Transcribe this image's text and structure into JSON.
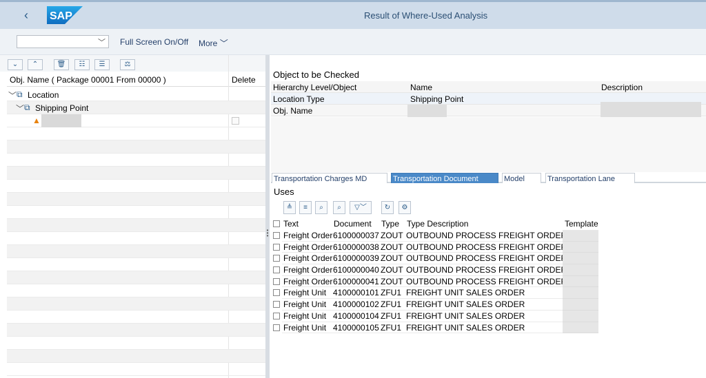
{
  "shell": {
    "back_icon": "chevron-left-icon",
    "logo_text": "SAP",
    "title": "Result of Where-Used Analysis",
    "brand_color": "#1a73c8"
  },
  "toolbar": {
    "select_value": "",
    "fullscreen_label": "Full Screen On/Off",
    "more_label": "More"
  },
  "left_panel": {
    "toolbar_icons": [
      "expand-all-icon",
      "collapse-all-icon",
      "delete-icon",
      "select-all-icon",
      "deselect-all-icon",
      "compare-icon"
    ],
    "columns": {
      "name": "Obj. Name ( Package 00001 From 00000 )",
      "delete": "Delete"
    },
    "tree": [
      {
        "label": "Location",
        "level": 0
      },
      {
        "label": "Shipping Point",
        "level": 1
      }
    ]
  },
  "object_to_check": {
    "title": "Object to be Checked",
    "columns": [
      "Hierarchy Level/Object",
      "Name",
      "Description"
    ],
    "rows": [
      {
        "level": "Location Type",
        "name": "Shipping Point",
        "description": ""
      },
      {
        "level": "Obj. Name",
        "name": "",
        "description": ""
      }
    ]
  },
  "tabs": [
    {
      "label": "Transportation Charges MD",
      "active": false
    },
    {
      "label": "Transportation Document",
      "active": true
    },
    {
      "label": "Model",
      "active": false
    },
    {
      "label": "Transportation Lane",
      "active": false
    }
  ],
  "uses": {
    "title": "Uses",
    "toolbar_icons": [
      "sort-ascending-icon",
      "sort-descending-icon",
      "find-icon",
      "find-next-icon",
      "filter-icon",
      "refresh-icon",
      "settings-icon"
    ],
    "columns": {
      "text": "Text",
      "document": "Document",
      "type": "Type",
      "type_description": "Type Description",
      "template": "Template"
    },
    "rows": [
      {
        "text": "Freight Order",
        "document": "6100000037",
        "type": "ZOUT",
        "type_description": "OUTBOUND PROCESS FREIGHT ORDER"
      },
      {
        "text": "Freight Order",
        "document": "6100000038",
        "type": "ZOUT",
        "type_description": "OUTBOUND PROCESS FREIGHT ORDER"
      },
      {
        "text": "Freight Order",
        "document": "6100000039",
        "type": "ZOUT",
        "type_description": "OUTBOUND PROCESS FREIGHT ORDER"
      },
      {
        "text": "Freight Order",
        "document": "6100000040",
        "type": "ZOUT",
        "type_description": "OUTBOUND PROCESS FREIGHT ORDER"
      },
      {
        "text": "Freight Order",
        "document": "6100000041",
        "type": "ZOUT",
        "type_description": "OUTBOUND PROCESS FREIGHT ORDER"
      },
      {
        "text": "Freight Unit",
        "document": "4100000101",
        "type": "ZFU1",
        "type_description": "FREIGHT UNIT SALES ORDER"
      },
      {
        "text": "Freight Unit",
        "document": "4100000102",
        "type": "ZFU1",
        "type_description": "FREIGHT UNIT SALES ORDER"
      },
      {
        "text": "Freight Unit",
        "document": "4100000104",
        "type": "ZFU1",
        "type_description": "FREIGHT UNIT SALES ORDER"
      },
      {
        "text": "Freight Unit",
        "document": "4100000105",
        "type": "ZFU1",
        "type_description": "FREIGHT UNIT SALES ORDER"
      }
    ]
  }
}
